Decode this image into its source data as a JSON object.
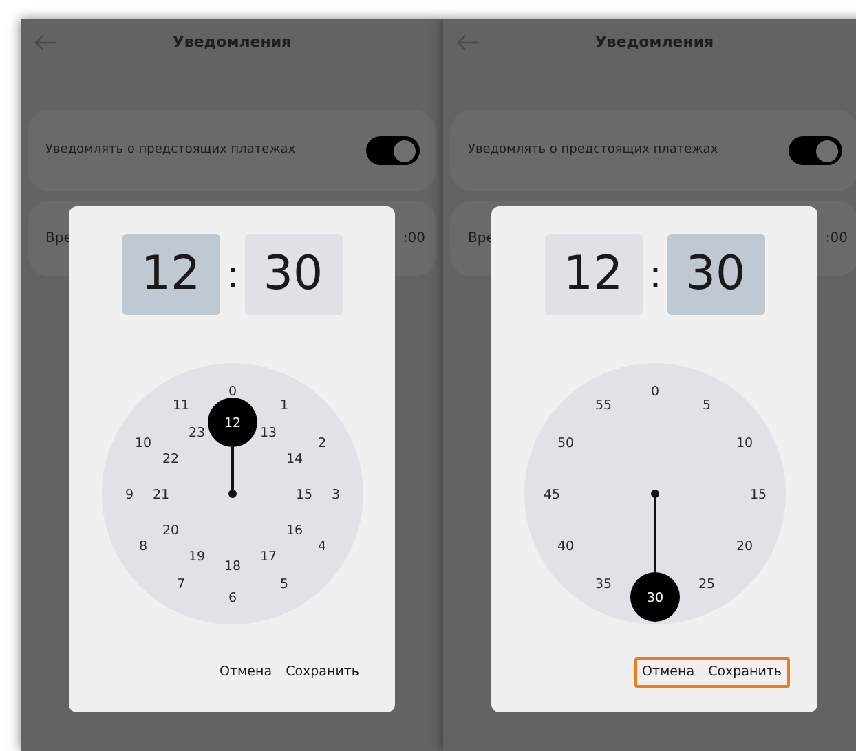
{
  "panels": [
    {
      "header": {
        "title": "Уведомления"
      },
      "toggle_card": {
        "label": "Уведомлять о предстоящих платежах",
        "on": true
      },
      "time_card": {
        "label": "Вре",
        "value": ":00"
      },
      "dialog": {
        "hour": {
          "text": "12",
          "selected": true
        },
        "separator": ":",
        "minute": {
          "text": "30",
          "selected": false
        },
        "dial": {
          "rings": [
            {
              "kind": "outer",
              "marks": [
                {
                  "text": "0",
                  "selected": false
                },
                {
                  "text": "1",
                  "selected": false
                },
                {
                  "text": "2",
                  "selected": false
                },
                {
                  "text": "3",
                  "selected": false
                },
                {
                  "text": "4",
                  "selected": false
                },
                {
                  "text": "5",
                  "selected": false
                },
                {
                  "text": "6",
                  "selected": false
                },
                {
                  "text": "7",
                  "selected": false
                },
                {
                  "text": "8",
                  "selected": false
                },
                {
                  "text": "9",
                  "selected": false
                },
                {
                  "text": "10",
                  "selected": false
                },
                {
                  "text": "11",
                  "selected": false
                }
              ]
            },
            {
              "kind": "inner",
              "marks": [
                {
                  "text": "12",
                  "selected": true
                },
                {
                  "text": "13",
                  "selected": false
                },
                {
                  "text": "14",
                  "selected": false
                },
                {
                  "text": "15",
                  "selected": false
                },
                {
                  "text": "16",
                  "selected": false
                },
                {
                  "text": "17",
                  "selected": false
                },
                {
                  "text": "18",
                  "selected": false
                },
                {
                  "text": "19",
                  "selected": false
                },
                {
                  "text": "20",
                  "selected": false
                },
                {
                  "text": "21",
                  "selected": false
                },
                {
                  "text": "22",
                  "selected": false
                },
                {
                  "text": "23",
                  "selected": false
                }
              ]
            }
          ]
        },
        "cancel": "Отмена",
        "save": "Сохранить",
        "actions_highlighted": false
      }
    },
    {
      "header": {
        "title": "Уведомления"
      },
      "toggle_card": {
        "label": "Уведомлять о предстоящих платежах",
        "on": true
      },
      "time_card": {
        "label": "Вре",
        "value": ":00"
      },
      "dialog": {
        "hour": {
          "text": "12",
          "selected": false
        },
        "separator": ":",
        "minute": {
          "text": "30",
          "selected": true
        },
        "dial": {
          "rings": [
            {
              "kind": "outer",
              "marks": [
                {
                  "text": "0",
                  "selected": false
                },
                {
                  "text": "5",
                  "selected": false
                },
                {
                  "text": "10",
                  "selected": false
                },
                {
                  "text": "15",
                  "selected": false
                },
                {
                  "text": "20",
                  "selected": false
                },
                {
                  "text": "25",
                  "selected": false
                },
                {
                  "text": "30",
                  "selected": true
                },
                {
                  "text": "35",
                  "selected": false
                },
                {
                  "text": "40",
                  "selected": false
                },
                {
                  "text": "45",
                  "selected": false
                },
                {
                  "text": "50",
                  "selected": false
                },
                {
                  "text": "55",
                  "selected": false
                }
              ]
            }
          ]
        },
        "cancel": "Отмена",
        "save": "Сохранить",
        "actions_highlighted": true
      }
    }
  ]
}
